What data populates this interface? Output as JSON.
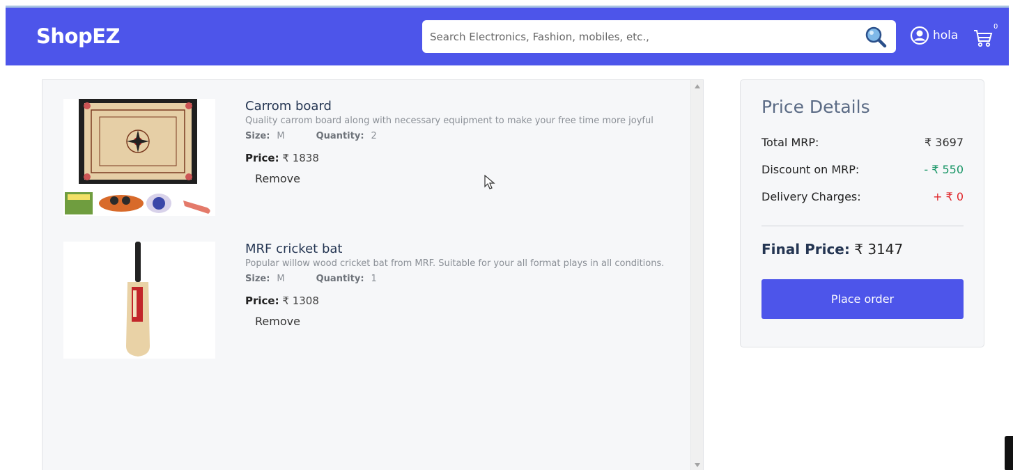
{
  "header": {
    "logo": "ShopEZ",
    "search_placeholder": "Search Electronics, Fashion, mobiles, etc.,",
    "user_name": "hola",
    "cart_count": "0"
  },
  "cart": {
    "items": [
      {
        "title": "Carrom board",
        "description": "Quality carrom board along with necessary equipment to make your free time more joyful",
        "size_label": "Size:",
        "size": "M",
        "quantity_label": "Quantity:",
        "quantity": "2",
        "price_label": "Price:",
        "price": "₹ 1838",
        "remove_label": "Remove"
      },
      {
        "title": "MRF cricket bat",
        "description": "Popular willow wood cricket bat from MRF. Suitable for your all format plays in all conditions.",
        "size_label": "Size:",
        "size": "M",
        "quantity_label": "Quantity:",
        "quantity": "1",
        "price_label": "Price:",
        "price": "₹ 1308",
        "remove_label": "Remove"
      }
    ]
  },
  "price_details": {
    "title": "Price Details",
    "total_mrp_label": "Total MRP:",
    "total_mrp": "₹ 3697",
    "discount_label": "Discount on MRP:",
    "discount": "- ₹ 550",
    "delivery_label": "Delivery Charges:",
    "delivery": "+ ₹ 0",
    "final_label": "Final Price:",
    "final_price": "₹ 3147",
    "place_order_label": "Place order"
  },
  "colors": {
    "brand": "#4d55ea",
    "discount": "#179565",
    "delivery": "#e0262a"
  }
}
